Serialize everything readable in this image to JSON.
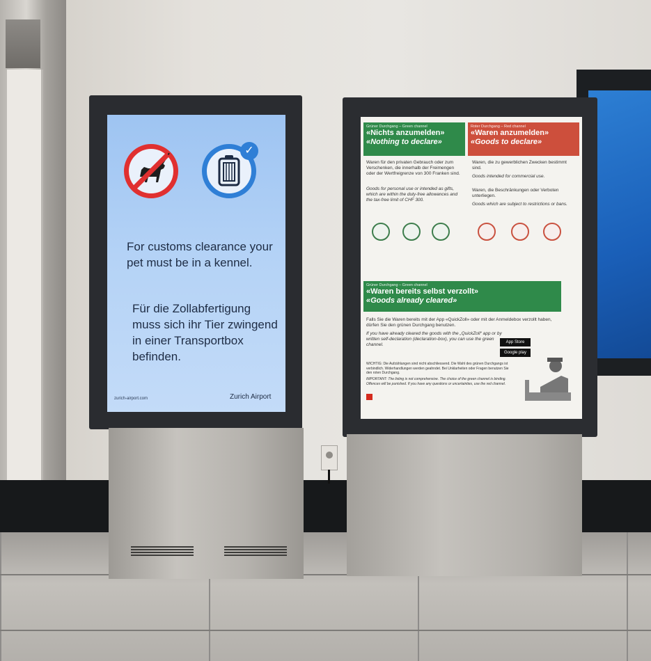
{
  "left_kiosk": {
    "headline_en": "For customs clearance your pet must be in a kennel.",
    "headline_de": "Für die Zollabfertigung muss sich ihr Tier zwingend in einer Transportbox befinden.",
    "url": "zurich-airport.com",
    "brand": "Zurich Airport",
    "icons": [
      "no-pet-on-leash-icon",
      "pet-kennel-checkmark-icon"
    ]
  },
  "right_poster": {
    "green_channel": {
      "subtitle": "Grüner Durchgang – Green channel",
      "title_de": "«Nichts anzumelden»",
      "title_en": "«Nothing to declare»",
      "text_de": "Waren für den privaten Gebrauch oder zum Verschenken, die innerhalb der Freimengen oder der Wertfreigrenze von 300 Franken sind.",
      "text_en": "Goods for personal use or intended as gifts, which are within the duty-free allowances and the tax-free limit of CHF 300."
    },
    "red_channel": {
      "subtitle": "Roter Durchgang – Red channel",
      "title_de": "«Waren anzumelden»",
      "title_en": "«Goods to declare»",
      "text_de": "Waren, die zu gewerblichen Zwecken bestimmt sind.",
      "text_en": "Goods intended for commercial use.",
      "text_de2": "Waren, die Beschränkungen oder Verboten unterliegen.",
      "text_en2": "Goods which are subject to restrictions or bans."
    },
    "cleared": {
      "subtitle": "Grüner Durchgang – Green channel",
      "title_de": "«Waren bereits selbst verzollt»",
      "title_en": "«Goods already cleared»",
      "text_de": "Falls Sie die Waren bereits mit der App «QuickZoll» oder mit der Anmeldebox verzollt haben, dürfen Sie den grünen Durchgang benutzen.",
      "text_en": "If you have already cleared the goods with the „QuickZoll“ app or by written self-declaration (declaration-box), you can use the green channel.",
      "app_store": "App Store",
      "google_play": "Google play"
    },
    "important_de": "WICHTIG: Die Aufzählungen sind nicht abschliessend. Die Wahl des grünen Durchgangs ist verbindlich. Widerhandlungen werden geahndet. Bei Unklarheiten oder Fragen benutzen Sie den roten Durchgang.",
    "important_en": "IMPORTANT: The listing is not comprehensive. The choice of the green channel is binding. Offences will be punished. If you have any questions or uncertainties, use the red channel."
  }
}
